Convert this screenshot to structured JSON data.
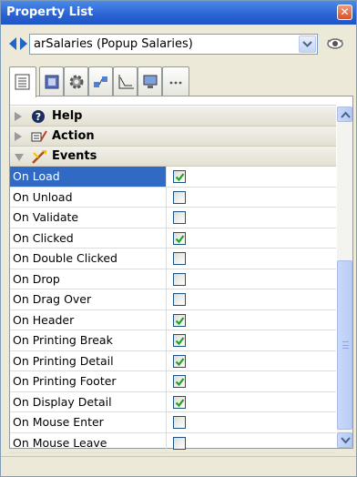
{
  "window": {
    "title": "Property List",
    "close_glyph": "✕"
  },
  "selector": {
    "value": "arSalaries (Popup Salaries)"
  },
  "tabs": [
    {
      "icon": "list-icon",
      "active": true
    },
    {
      "icon": "format-icon",
      "active": false
    },
    {
      "icon": "gear-icon",
      "active": false
    },
    {
      "icon": "data-icon",
      "active": false
    },
    {
      "icon": "chart-icon",
      "active": false
    },
    {
      "icon": "monitor-icon",
      "active": false
    },
    {
      "icon": "more-icon",
      "active": false
    }
  ],
  "groups": {
    "help": {
      "label": "Help",
      "expanded": false
    },
    "action": {
      "label": "Action",
      "expanded": false
    },
    "events": {
      "label": "Events",
      "expanded": true
    }
  },
  "events": [
    {
      "label": "On Load",
      "checked": true,
      "selected": true
    },
    {
      "label": "On Unload",
      "checked": false,
      "selected": false
    },
    {
      "label": "On Validate",
      "checked": false,
      "selected": false
    },
    {
      "label": "On Clicked",
      "checked": true,
      "selected": false
    },
    {
      "label": "On Double Clicked",
      "checked": false,
      "selected": false
    },
    {
      "label": "On Drop",
      "checked": false,
      "selected": false
    },
    {
      "label": "On Drag Over",
      "checked": false,
      "selected": false
    },
    {
      "label": "On Header",
      "checked": true,
      "selected": false
    },
    {
      "label": "On Printing Break",
      "checked": true,
      "selected": false
    },
    {
      "label": "On Printing Detail",
      "checked": true,
      "selected": false
    },
    {
      "label": "On Printing Footer",
      "checked": true,
      "selected": false
    },
    {
      "label": "On Display Detail",
      "checked": true,
      "selected": false
    },
    {
      "label": "On Mouse Enter",
      "checked": false,
      "selected": false
    },
    {
      "label": "On Mouse Leave",
      "checked": false,
      "selected": false
    }
  ],
  "colors": {
    "titlebar": "#2a62d3",
    "selection": "#316ac5",
    "check": "#21a121"
  }
}
